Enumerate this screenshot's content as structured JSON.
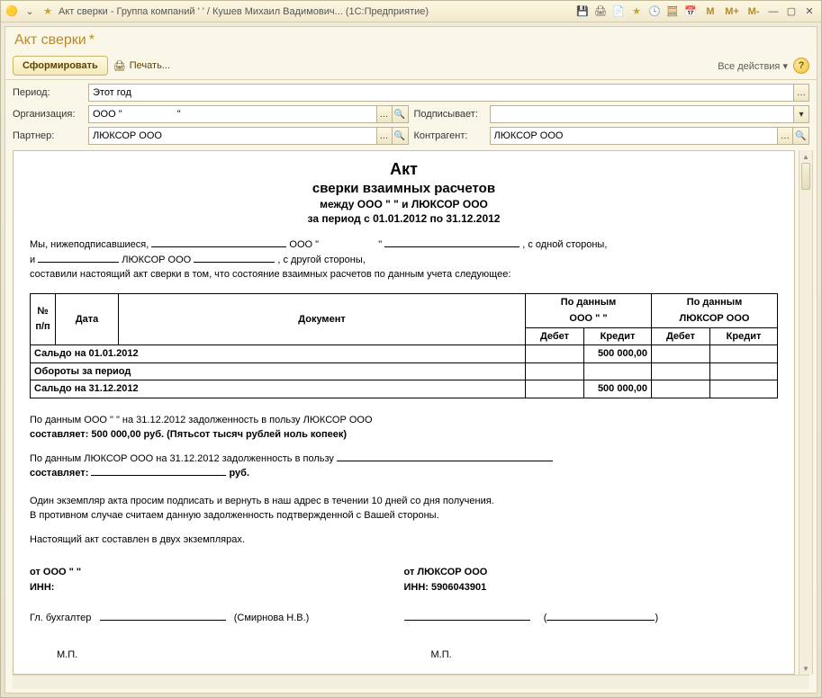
{
  "window": {
    "title": "Акт сверки - Группа компаний '                ' / Кушев Михаил Вадимович... (1С:Предприятие)"
  },
  "doc_title": "Акт сверки",
  "doc_title_suffix": "*",
  "toolbar": {
    "generate": "Сформировать",
    "print": "Печать...",
    "all_actions": "Все действия",
    "help": "?"
  },
  "filters": {
    "period_label": "Период:",
    "period_value": "Этот год",
    "org_label": "Организация:",
    "org_value": "ООО \"                    \"",
    "signer_label": "Подписывает:",
    "signer_value": "",
    "partner_label": "Партнер:",
    "partner_value": "ЛЮКСОР ООО",
    "counterparty_label": "Контрагент:",
    "counterparty_value": "ЛЮКСОР ООО"
  },
  "rep": {
    "title1": "Акт",
    "title2": "сверки взаимных расчетов",
    "between": "между ООО \"                   \" и ЛЮКСОР ООО",
    "period": "за период с 01.01.2012 по 31.12.2012",
    "intro1a": "Мы, нижеподписавшиеся, ",
    "intro1b": " ООО \"",
    "intro1c": "\" ",
    "intro1d": ", с одной стороны,",
    "intro2a": "и ",
    "intro2b": " ЛЮКСОР ООО ",
    "intro2c": ", с другой стороны,",
    "intro3": "составили настоящий акт сверки в том, что состояние взаимных расчетов по данным учета следующее:",
    "tbl": {
      "col_num": "№ п/п",
      "col_date": "Дата",
      "col_doc": "Документ",
      "col_by1": "По данным",
      "col_by1_sub": "ООО \"                  \"",
      "col_by2": "По данным",
      "col_by2_sub": "ЛЮКСОР ООО",
      "col_debit": "Дебет",
      "col_credit": "Кредит",
      "rows": [
        {
          "label": "Сальдо на 01.01.2012",
          "d1": "",
          "c1": "500 000,00",
          "d2": "",
          "c2": ""
        },
        {
          "label": "Обороты за период",
          "d1": "",
          "c1": "",
          "d2": "",
          "c2": ""
        },
        {
          "label": "Сальдо на 31.12.2012",
          "d1": "",
          "c1": "500 000,00",
          "d2": "",
          "c2": ""
        }
      ]
    },
    "debt1a": "По данным ООО \"                 \" на 31.12.2012 задолженность в пользу ЛЮКСОР ООО",
    "debt1b": "составляет: 500 000,00 руб. (Пятьсот тысяч рублей ноль копеек)",
    "debt2a": "По данным ЛЮКСОР ООО на 31.12.2012 задолженность в пользу ",
    "debt2b": "составляет: ",
    "debt2c": " руб.",
    "note1": "Один экземпляр акта просим подписать и вернуть в наш адрес в течении 10 дней со дня получения.",
    "note2": "В противном случае считаем данную задолженность подтвержденной с Вашей стороны.",
    "note3": "Настоящий акт составлен в двух экземплярах.",
    "from1": "от ООО \"                  \"",
    "from2": "от ЛЮКСОР ООО",
    "inn1": "ИНН:",
    "inn2": "ИНН: 5906043901",
    "acc": "Гл. бухгалтер",
    "acc_name": "(Смирнова Н.В.)",
    "mp": "М.П."
  },
  "mem_indicators": {
    "m": "M",
    "mplus": "M+",
    "mminus": "M-"
  }
}
